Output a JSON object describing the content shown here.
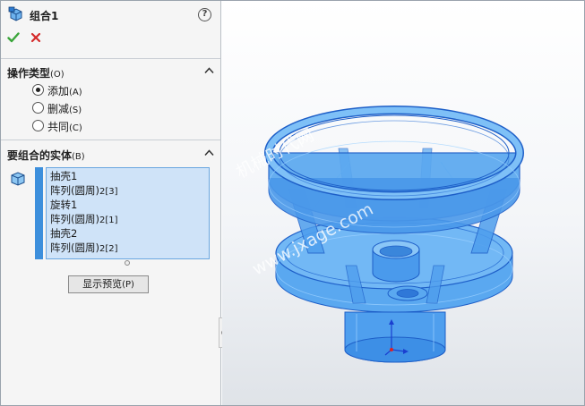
{
  "feature": {
    "title": "组合1",
    "help_label": "?"
  },
  "operation_type": {
    "heading": "操作类型",
    "hotkey": "(O)",
    "options": [
      {
        "label": "添加",
        "hotkey": "(A)",
        "checked": true
      },
      {
        "label": "删减",
        "hotkey": "(S)",
        "checked": false
      },
      {
        "label": "共同",
        "hotkey": "(C)",
        "checked": false
      }
    ]
  },
  "bodies_to_combine": {
    "heading": "要组合的实体",
    "hotkey": "(B)",
    "items": [
      {
        "name": "抽壳1",
        "suffix": ""
      },
      {
        "name": "阵列(圆周)",
        "suffix": "2[3]"
      },
      {
        "name": "旋转1",
        "suffix": ""
      },
      {
        "name": "阵列(圆周)",
        "suffix": "2[1]"
      },
      {
        "name": "抽壳2",
        "suffix": ""
      },
      {
        "name": "阵列(圆周)",
        "suffix": "2[2]"
      }
    ]
  },
  "preview_button": {
    "label": "显示预览",
    "hotkey": "(P)"
  },
  "viewport": {
    "watermark_line1": "机械时代网",
    "watermark_line2": "www.jxage.com"
  },
  "colors": {
    "accent": "#3d8fdc",
    "list_bg": "#cfe3f8",
    "model_fill": "#5aa8f0",
    "model_edge": "#1e5fc8",
    "ok_green": "#3aa53a",
    "cancel_red": "#d42a2a"
  }
}
